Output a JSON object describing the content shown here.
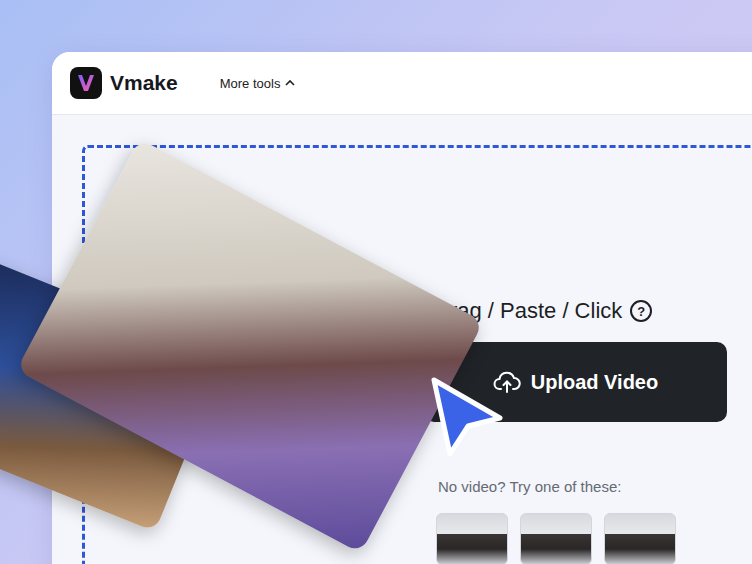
{
  "app": {
    "name": "Vmake",
    "menu": {
      "label": "More tools",
      "expanded": true
    }
  },
  "upload": {
    "prompt": "Drag / Paste / Click",
    "help_icon": "?",
    "button": "Upload Video"
  },
  "samples": {
    "label": "No video? Try one of these:",
    "items": [
      {
        "kind": "video"
      },
      {
        "kind": "video"
      },
      {
        "kind": "video"
      }
    ]
  }
}
